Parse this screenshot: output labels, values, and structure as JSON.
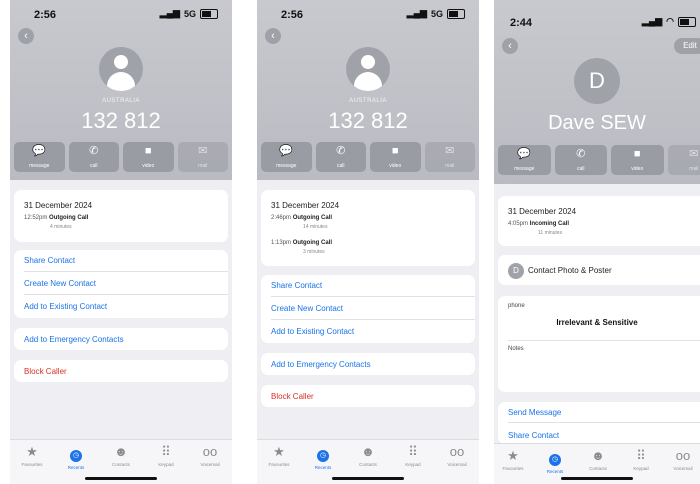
{
  "tabbar": {
    "labels": [
      "Favourites",
      "Recents",
      "Contacts",
      "Keypad",
      "Voicemail"
    ],
    "icons": [
      "star-icon",
      "clock-icon",
      "person-icon",
      "keypad-icon",
      "voicemail-icon"
    ]
  },
  "screen1": {
    "time": "2:56",
    "network": "5G",
    "country": "AUSTRALIA",
    "number": "132 812",
    "actions": [
      "message",
      "call",
      "video",
      "mail"
    ],
    "date": "31 December 2024",
    "calls": [
      {
        "time": "12:52pm",
        "type": "Outgoing Call",
        "duration": "4 minutes"
      }
    ],
    "options": [
      "Share Contact",
      "Create New Contact",
      "Add to Existing Contact"
    ],
    "emergency": "Add to Emergency Contacts",
    "block": "Block Caller"
  },
  "screen2": {
    "time": "2:56",
    "network": "5G",
    "country": "AUSTRALIA",
    "number": "132 812",
    "actions": [
      "message",
      "call",
      "video",
      "mail"
    ],
    "date": "31 December 2024",
    "calls": [
      {
        "time": "2:46pm",
        "type": "Outgoing Call",
        "duration": "14 minutes"
      },
      {
        "time": "1:13pm",
        "type": "Outgoing Call",
        "duration": "3 minutes"
      }
    ],
    "options": [
      "Share Contact",
      "Create New Contact",
      "Add to Existing Contact"
    ],
    "emergency": "Add to Emergency Contacts",
    "block": "Block Caller"
  },
  "screen3": {
    "time": "2:44",
    "edit": "Edit",
    "initial": "D",
    "name": "Dave SEW",
    "actions": [
      "message",
      "call",
      "video",
      "mail"
    ],
    "date": "31 December 2024",
    "calls": [
      {
        "time": "4:05pm",
        "type": "Incoming Call",
        "duration": "11 minutes"
      }
    ],
    "photo_poster": "Contact Photo & Poster",
    "phone_label": "phone",
    "redaction": "Irrelevant & Sensitive",
    "notes": "Notes",
    "send_message": "Send Message",
    "share_contact": "Share Contact"
  }
}
